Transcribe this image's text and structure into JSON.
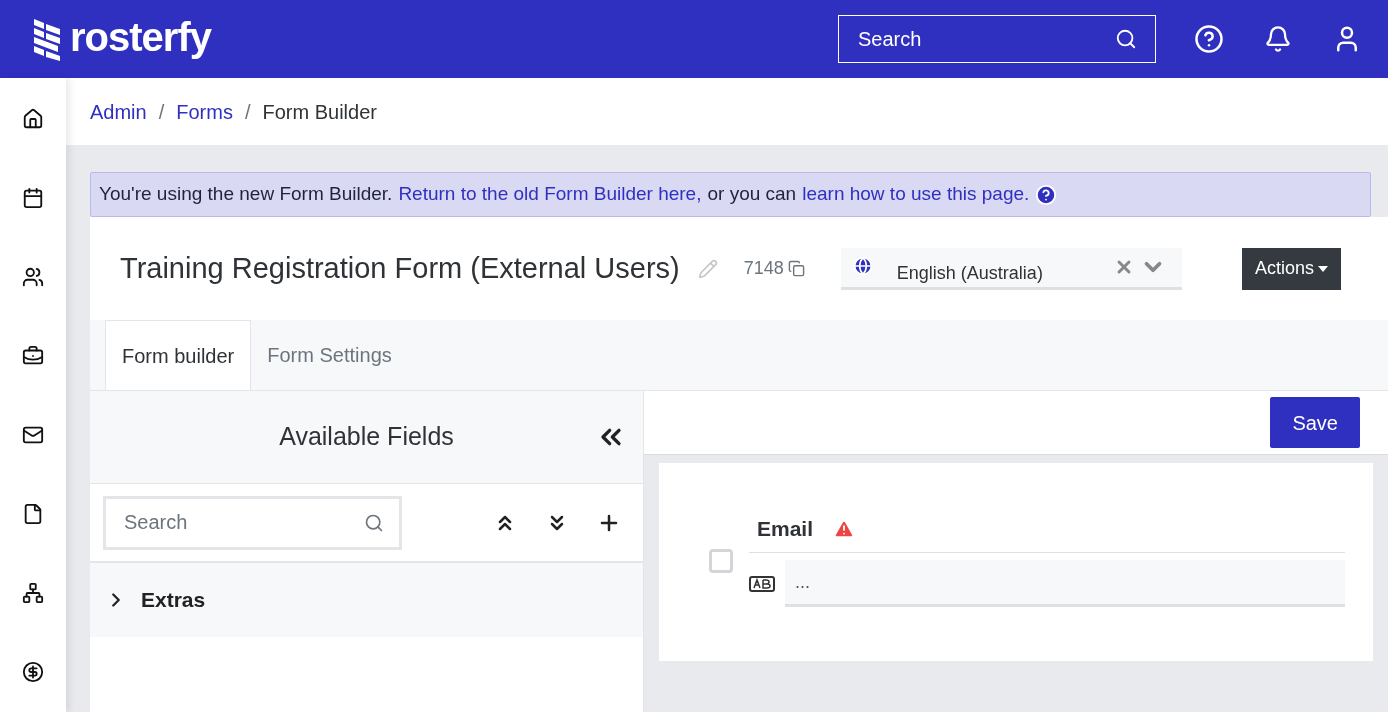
{
  "header": {
    "logo_text": "rosterfy",
    "search": {
      "placeholder": "Search"
    }
  },
  "breadcrumb": [
    {
      "kind": "link",
      "label": "Admin"
    },
    {
      "kind": "separator",
      "label": "/"
    },
    {
      "kind": "link",
      "label": "Forms"
    },
    {
      "kind": "separator",
      "label": "/"
    },
    {
      "kind": "current",
      "label": "Form Builder"
    }
  ],
  "banner": {
    "parts": [
      {
        "kind": "text",
        "text": "You're using the new Form Builder."
      },
      {
        "kind": "link",
        "text": "Return to the old Form Builder here,"
      },
      {
        "kind": "text",
        "text": "or you can"
      },
      {
        "kind": "link",
        "text": "learn how to use this page."
      }
    ]
  },
  "form": {
    "title": "Training Registration Form (External Users)",
    "id": "7148",
    "language": "English (Australia)",
    "actions": "Actions"
  },
  "tabs": [
    {
      "label": "Form builder",
      "selected": true
    },
    {
      "label": "Form Settings",
      "selected": false
    }
  ],
  "available_fields": {
    "title": "Available Fields",
    "search": {
      "placeholder": "Search"
    },
    "groups": [
      {
        "label": "Extras",
        "expanded": false
      }
    ]
  },
  "canvas": {
    "save": "Save",
    "fields": [
      {
        "label": "Email",
        "warning": true,
        "checked": false,
        "value": "..."
      }
    ]
  }
}
